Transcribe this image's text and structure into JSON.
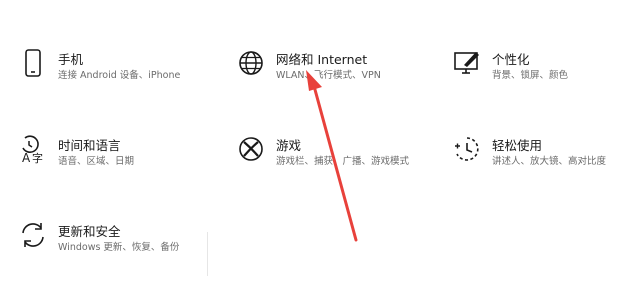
{
  "tiles": [
    {
      "title": "手机",
      "desc": "连接 Android 设备、iPhone",
      "icon": "phone-icon"
    },
    {
      "title": "网络和 Internet",
      "desc": "WLAN、飞行模式、VPN",
      "icon": "globe-icon"
    },
    {
      "title": "个性化",
      "desc": "背景、锁屏、颜色",
      "icon": "personalization-icon"
    },
    {
      "title": "时间和语言",
      "desc": "语音、区域、日期",
      "icon": "time-language-icon"
    },
    {
      "title": "游戏",
      "desc": "游戏栏、捕获、广播、游戏模式",
      "icon": "xbox-icon"
    },
    {
      "title": "轻松使用",
      "desc": "讲述人、放大镜、高对比度",
      "icon": "ease-of-access-icon"
    },
    {
      "title": "更新和安全",
      "desc": "Windows 更新、恢复、备份",
      "icon": "update-icon"
    }
  ],
  "annotation": {
    "color": "#e8413b",
    "icon": "red-arrow"
  }
}
